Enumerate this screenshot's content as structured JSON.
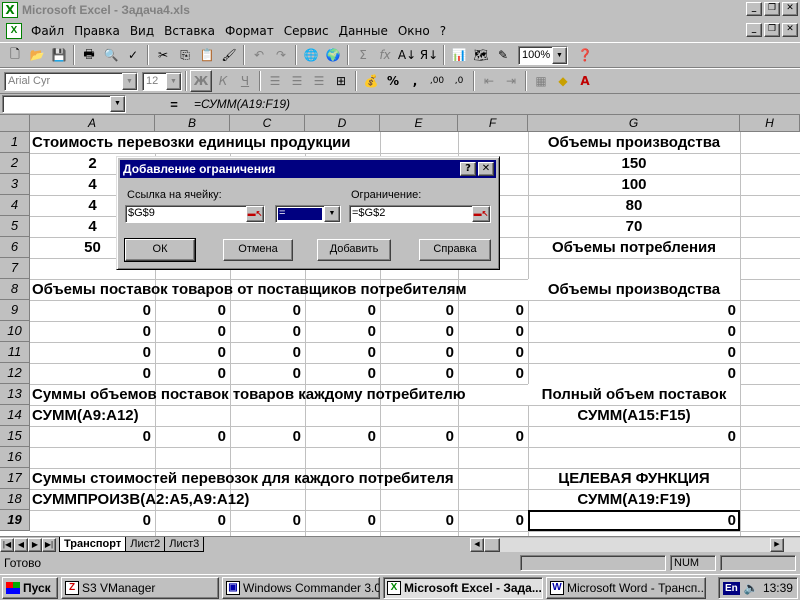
{
  "window": {
    "title": "Microsoft Excel - Задача4.xls"
  },
  "menu": {
    "items": [
      "Файл",
      "Правка",
      "Вид",
      "Вставка",
      "Формат",
      "Сервис",
      "Данные",
      "Окно",
      "?"
    ]
  },
  "toolbar": {
    "zoom": "100%",
    "font_name": "Arial Cyr",
    "font_size": "12",
    "bold": "Ж",
    "italic": "К",
    "underline": "Ч",
    "percent": "%",
    "comma": ",",
    "sigma": "Σ",
    "fx": "fx"
  },
  "formula_bar": {
    "name_box": "",
    "equals": "=",
    "formula": "=СУММ(A19:F19)"
  },
  "sheet": {
    "columns": [
      "A",
      "B",
      "C",
      "D",
      "E",
      "F",
      "G",
      "H"
    ],
    "rows": [
      "1",
      "2",
      "3",
      "4",
      "5",
      "6",
      "7",
      "8",
      "9",
      "10",
      "11",
      "12",
      "13",
      "14",
      "15",
      "16",
      "17",
      "18",
      "19"
    ],
    "r1_text": "Стоимость перевозки единицы продукции",
    "r1_g": "Объемы производства",
    "r2_a": "2",
    "r2_g": "150",
    "r3_a": "4",
    "r3_g": "100",
    "r4_a": "4",
    "r4_g": "80",
    "r5_a": "4",
    "r5_g": "70",
    "r6_a": "50",
    "r6_g": "Объемы потребления",
    "r8_text": "Объемы поставок товаров от поставщиков потребителям",
    "r8_g": "Объемы производства",
    "zero_rows": {
      "r9": [
        "0",
        "0",
        "0",
        "0",
        "0",
        "0",
        "0"
      ],
      "r10": [
        "0",
        "0",
        "0",
        "0",
        "0",
        "0",
        "0"
      ],
      "r11": [
        "0",
        "0",
        "0",
        "0",
        "0",
        "0",
        "0"
      ],
      "r12": [
        "0",
        "0",
        "0",
        "0",
        "0",
        "0",
        "0"
      ]
    },
    "r13_text": "Суммы объемов поставок товаров каждому потребителю",
    "r13_g": "Полный объем поставок",
    "r14_a": "СУММ(A9:A12)",
    "r14_g": "СУММ(A15:F15)",
    "r15": [
      "0",
      "0",
      "0",
      "0",
      "0",
      "0",
      "0"
    ],
    "r17_text": "Суммы стоимостей перевозок для каждого потребителя",
    "r17_g": "ЦЕЛЕВАЯ ФУНКЦИЯ",
    "r18_a": "СУММПРОИЗВ(A2:A5,A9:A12)",
    "r18_g": "СУММ(A19:F19)",
    "r19": [
      "0",
      "0",
      "0",
      "0",
      "0",
      "0",
      "0"
    ]
  },
  "tabs": [
    "Транспорт",
    "Лист2",
    "Лист3"
  ],
  "status": {
    "text": "Готово",
    "num": "NUM"
  },
  "taskbar": {
    "start": "Пуск",
    "items": [
      "S3 VManager",
      "Windows Commander 3.0...",
      "Microsoft Excel - Зада...",
      "Microsoft Word - Трансп..."
    ],
    "lang": "En",
    "clock": "13:39"
  },
  "dialog": {
    "title": "Добавление ограничения",
    "cell_ref_label": "Ссылка на ячейку:",
    "cell_ref_value": "$G$9",
    "operator": "=",
    "constraint_label": "Ограничение:",
    "constraint_value": "=$G$2",
    "ok": "ОК",
    "cancel": "Отмена",
    "add": "Добавить",
    "help": "Справка",
    "help_icon": "?",
    "close_icon": "✕"
  }
}
